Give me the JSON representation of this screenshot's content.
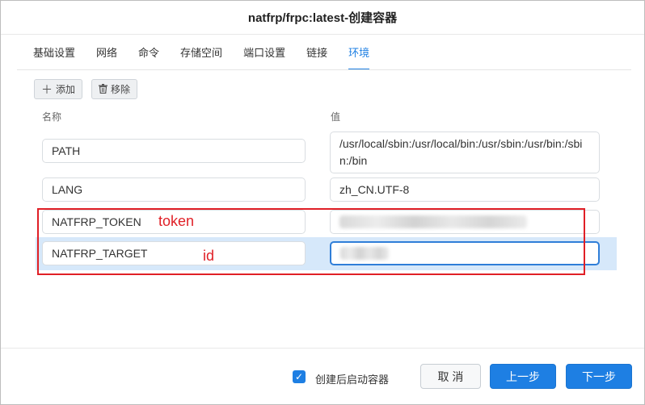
{
  "dialog": {
    "title": "natfrp/frpc:latest-创建容器"
  },
  "tabs": [
    {
      "label": "基础设置",
      "active": false
    },
    {
      "label": "网络",
      "active": false
    },
    {
      "label": "命令",
      "active": false
    },
    {
      "label": "存储空间",
      "active": false
    },
    {
      "label": "端口设置",
      "active": false
    },
    {
      "label": "链接",
      "active": false
    },
    {
      "label": "环境",
      "active": true
    }
  ],
  "toolbar": {
    "add_label": "添加",
    "add_icon": "plus-icon",
    "remove_label": "移除",
    "remove_icon": "trash-icon"
  },
  "columns": {
    "name": "名称",
    "value": "值"
  },
  "env_rows": [
    {
      "name": "PATH",
      "value": "/usr/local/sbin:/usr/local/bin:/usr/sbin:/usr/bin:/sbin:/bin"
    },
    {
      "name": "LANG",
      "value": "zh_CN.UTF-8"
    },
    {
      "name": "NATFRP_TOKEN",
      "value": ""
    },
    {
      "name": "NATFRP_TARGET",
      "value": ""
    }
  ],
  "annotations": {
    "token_label": "token",
    "id_label": "id",
    "color": "#e01f26"
  },
  "footer": {
    "checkbox_label": "创建后启动容器",
    "checkbox_checked": true,
    "cancel_label": "取 消",
    "prev_label": "上一步",
    "next_label": "下一步"
  },
  "colors": {
    "accent": "#1e7fe3",
    "row_highlight": "#d6e8fa",
    "annotation": "#e01f26"
  }
}
